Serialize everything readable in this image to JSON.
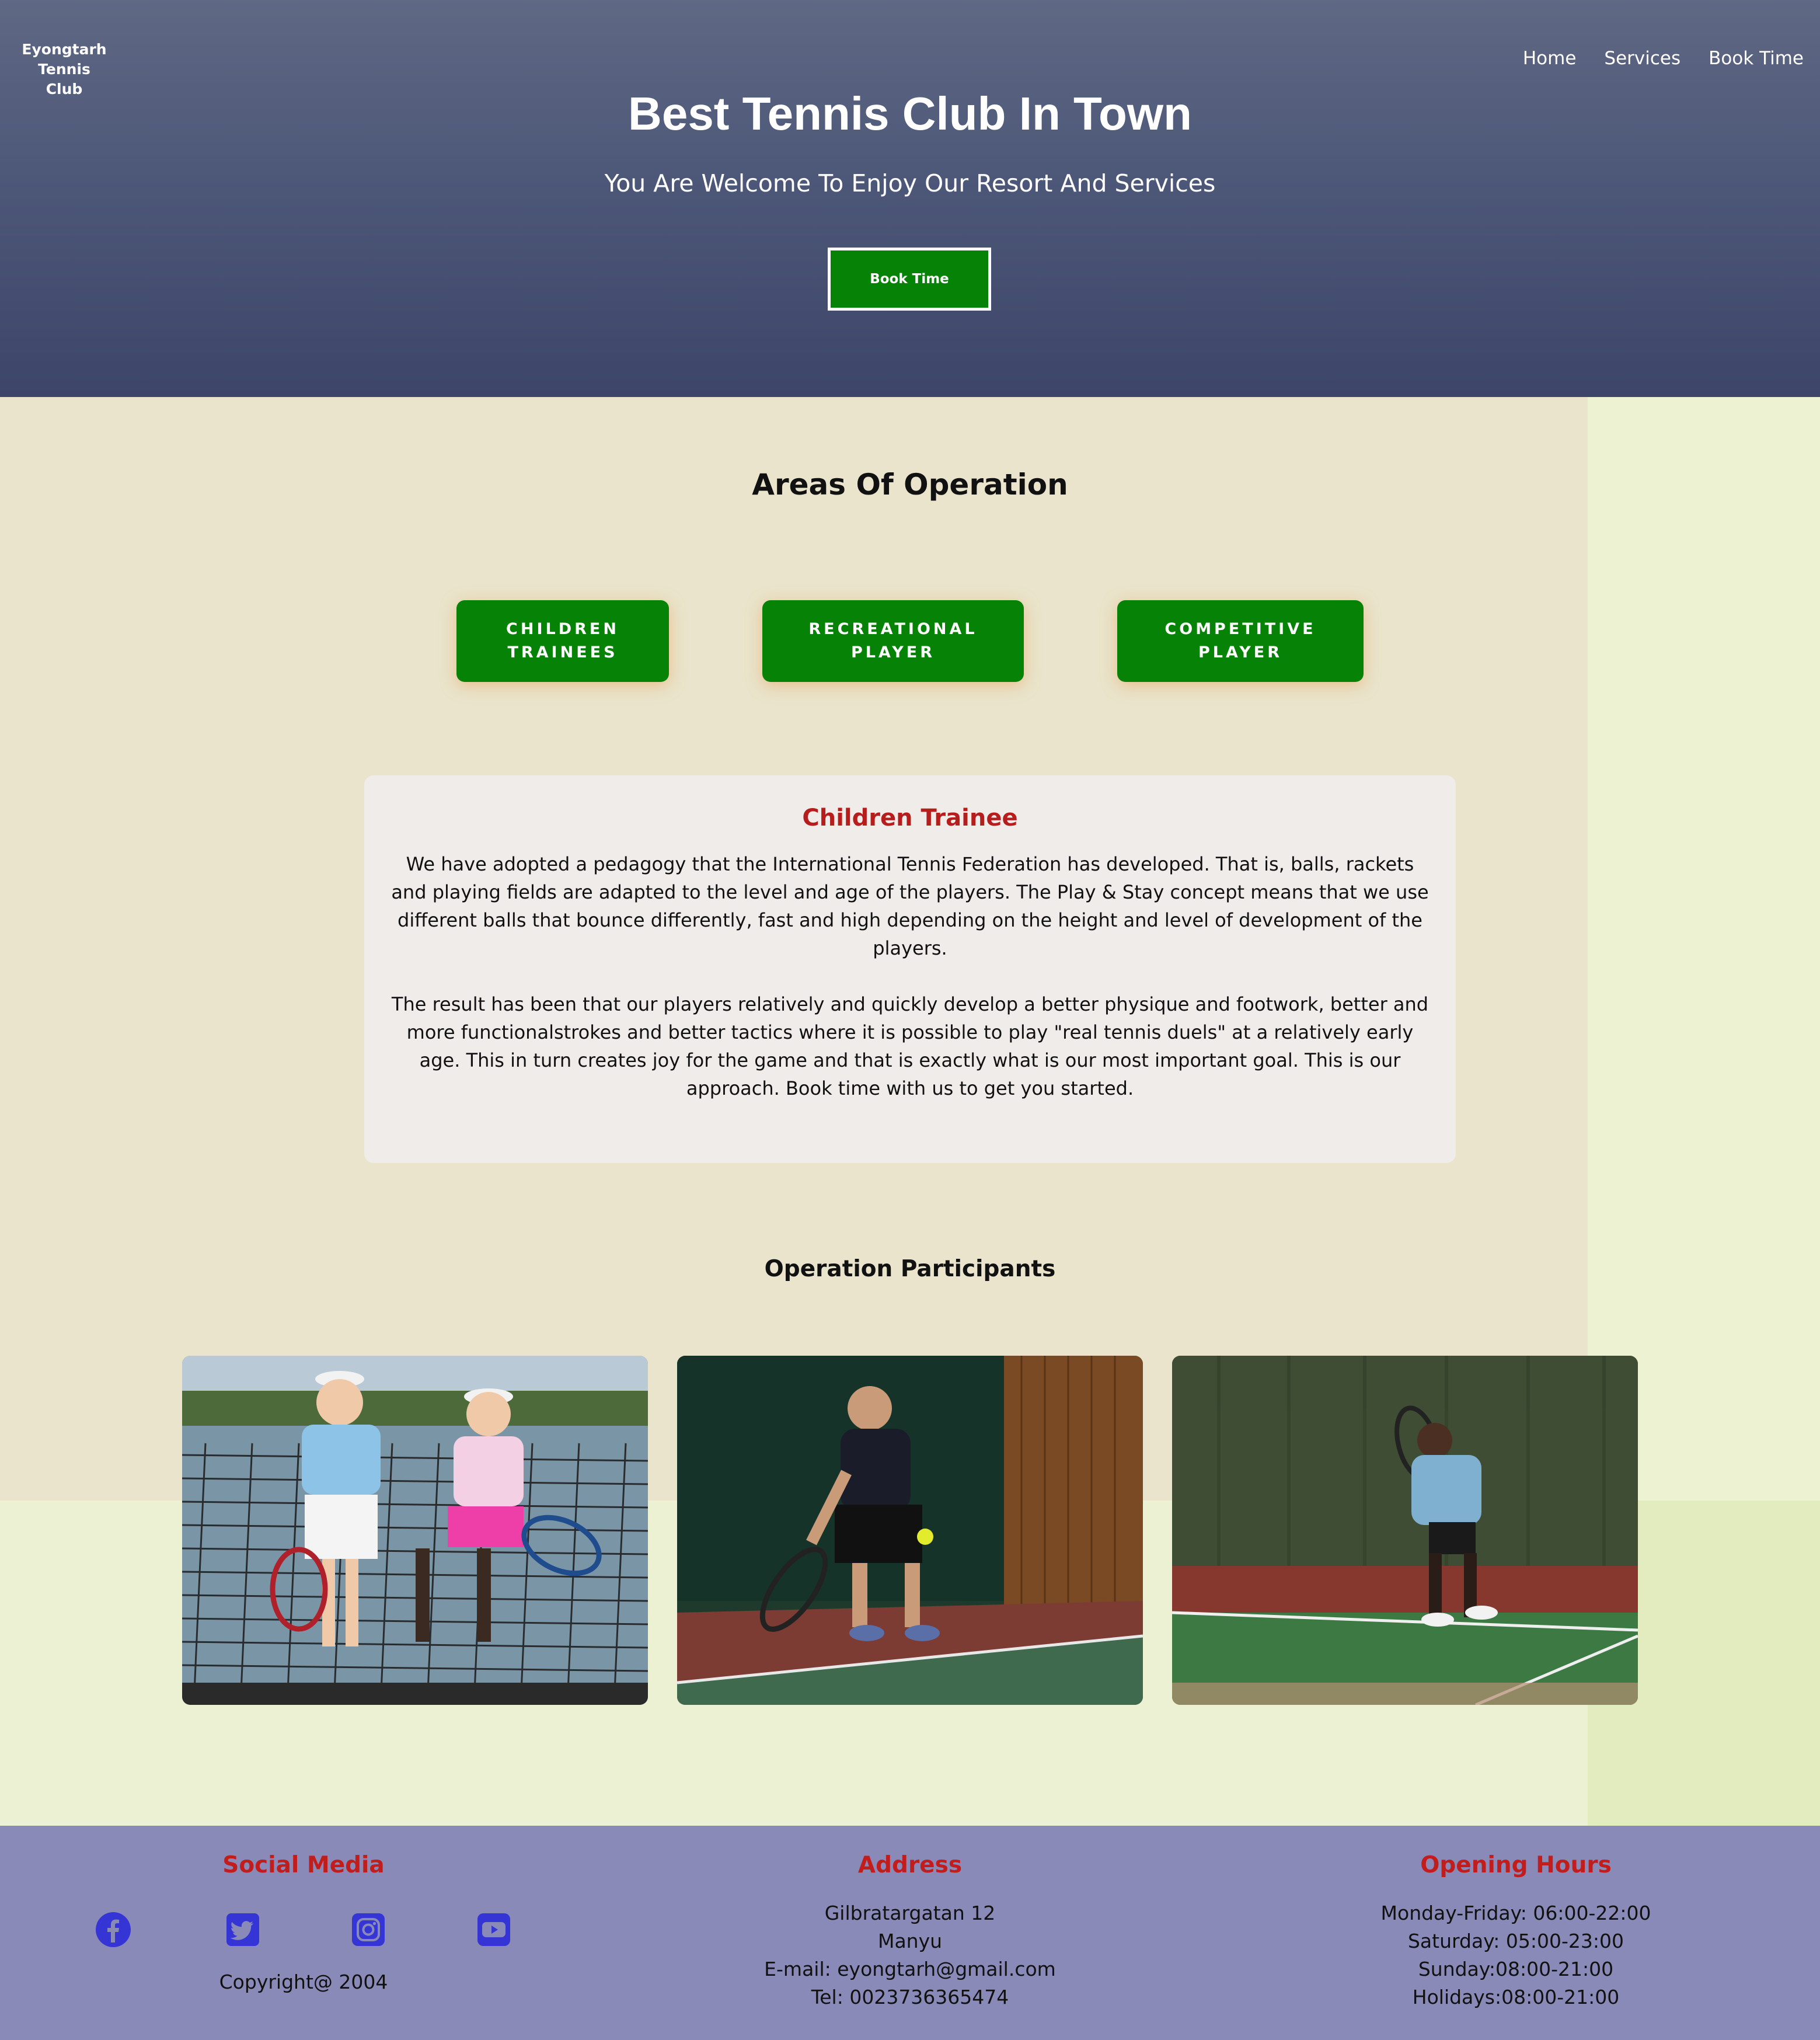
{
  "header": {
    "logo_line1": "Eyongtarh",
    "logo_line2": "Tennis Club",
    "nav": [
      "Home",
      "Services",
      "Book Time"
    ],
    "title": "Best Tennis Club In Town",
    "subtitle": "You Are Welcome To Enjoy Our Resort And Services",
    "cta_label": "Book Time"
  },
  "areas": {
    "title": "Areas Of Operation",
    "buttons": [
      "CHILDREN TRAINEES",
      "RECREATIONAL PLAYER",
      "COMPETITIVE PLAYER"
    ]
  },
  "info_card": {
    "title": "Children Trainee",
    "paragraph1": "We have adopted a pedagogy that the International Tennis Federation has developed. That is, balls, rackets and playing fields are adapted to the level and age of the players. The Play & Stay concept means that we use different balls that bounce differently, fast and high depending on the height and level of development of the players.",
    "paragraph2": "The result has been that our players relatively and quickly develop a better physique and footwork, better and more functionalstrokes and better tactics where it is possible to play \"real tennis duels\" at a relatively early age. This in turn creates joy for the game and that is exactly what is our most important goal. This is our approach. Book time with us to get you started."
  },
  "participants": {
    "title": "Operation Participants",
    "photos": [
      "children-players-photo",
      "recreational-player-photo",
      "competitive-player-photo"
    ]
  },
  "footer": {
    "social_title": "Social Media",
    "social_icons": [
      "facebook-icon",
      "twitter-icon",
      "instagram-icon",
      "youtube-icon"
    ],
    "copyright": "Copyright@ 2004",
    "address_title": "Address",
    "address_lines": [
      "Gilbratargatan 12",
      "Manyu",
      "E-mail: eyongtarh@gmail.com",
      "Tel: 0023736365474"
    ],
    "hours_title": "Opening Hours",
    "hours_lines": [
      "Monday-Friday: 06:00-22:00",
      "Saturday: 05:00-23:00",
      "Sunday:08:00-21:00",
      "Holidays:08:00-21:00"
    ]
  },
  "colors": {
    "brand_green": "#068306",
    "accent_red": "#c21d1d",
    "icon_blue": "#3535d6",
    "footer_bg": "#8a8ab8",
    "hero_bg": "#4d5778"
  }
}
